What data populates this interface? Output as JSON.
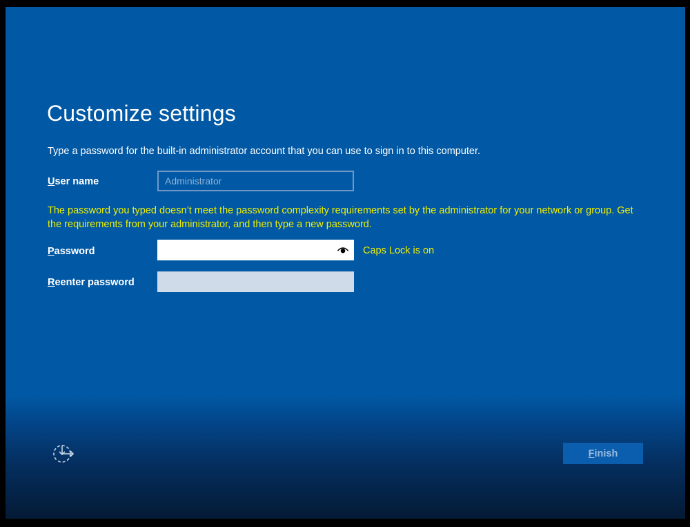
{
  "page": {
    "title": "Customize settings",
    "description": "Type a password for the built-in administrator account that you can use to sign in to this computer."
  },
  "fields": {
    "username": {
      "label_first": "U",
      "label_rest": "ser name",
      "placeholder": "Administrator",
      "value": ""
    },
    "password": {
      "label_first": "P",
      "label_rest": "assword",
      "value": ""
    },
    "reenter": {
      "label_first": "R",
      "label_rest": "eenter password",
      "value": ""
    }
  },
  "messages": {
    "complexity_error": "The password you typed doesn’t meet the password complexity requirements set by the administrator for your network or group. Get the requirements from your administrator, and then type a new password.",
    "caps_lock": "Caps Lock is on"
  },
  "buttons": {
    "finish_first": "F",
    "finish_rest": "inish",
    "finish_enabled": false
  },
  "icons": {
    "reveal": "eye-icon",
    "accessibility": "ease-of-access-icon"
  },
  "colors": {
    "background": "#0158a4",
    "warning_text": "#f0f000",
    "text": "#ffffff"
  }
}
